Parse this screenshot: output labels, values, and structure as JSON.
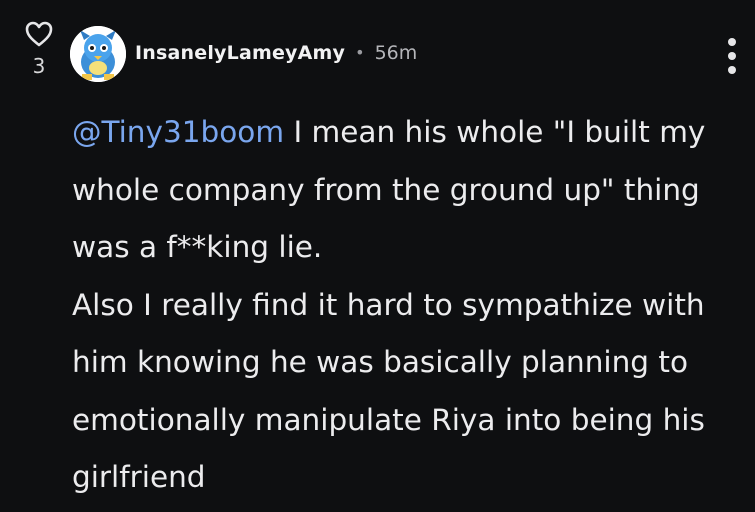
{
  "comment": {
    "likes": "3",
    "username": "InsanelyLameyAmy",
    "separator": "•",
    "time": "56m",
    "mention": "@Tiny31boom",
    "paragraph1": " I mean his whole \"I built my whole company from the ground up\" thing was a f**king lie.",
    "paragraph2": "Also I really find it hard to sympathize with him knowing he was basically planning to emotionally manipulate Riya into being his girlfriend"
  },
  "icons": {
    "like": "heart-icon",
    "more": "more-vertical-icon",
    "avatar": "avatar"
  },
  "colors": {
    "background": "#0e0f11",
    "mention": "#7aa6ee",
    "text": "#ececee",
    "muted": "#b5b6ba"
  }
}
